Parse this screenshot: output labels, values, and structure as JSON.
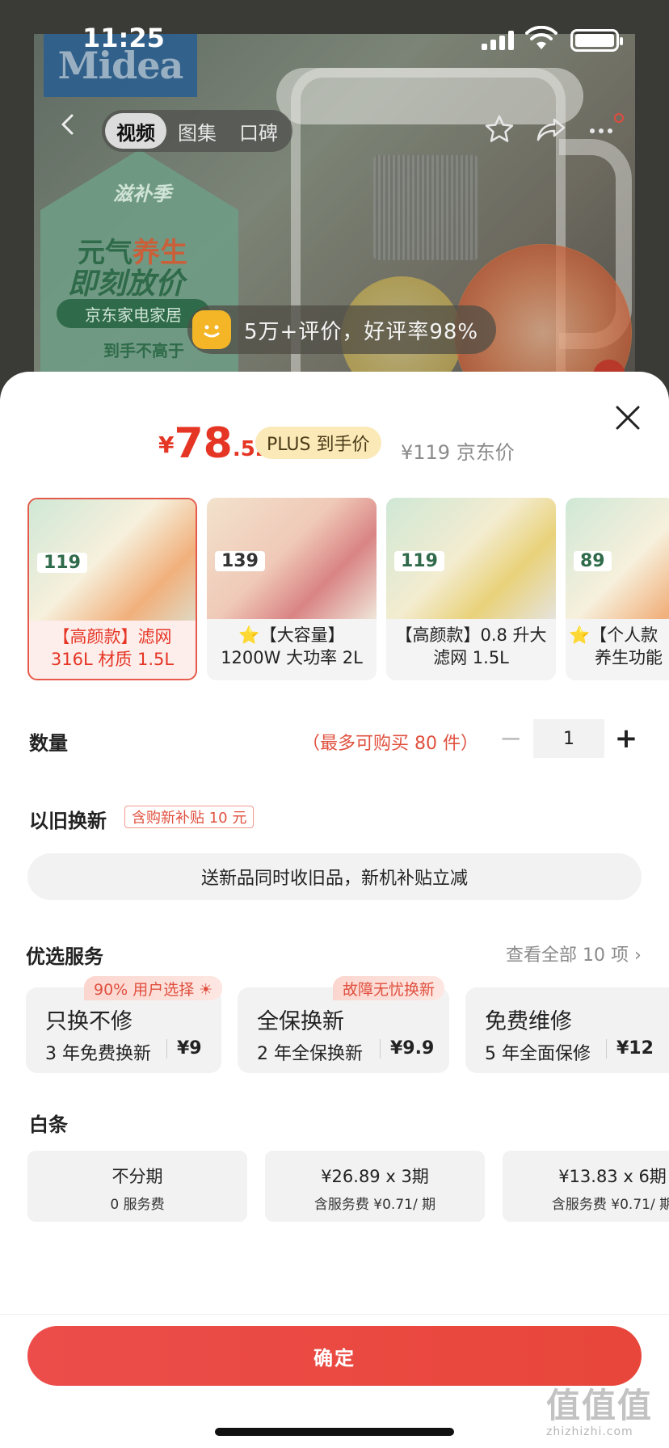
{
  "status_bar": {
    "time": "11:25"
  },
  "hero": {
    "brand": "Midea",
    "promo_line1": "滋补季",
    "promo_line2a": "元气",
    "promo_line2b": "养生",
    "promo_line3": "即刻放价",
    "promo_bar": "京东家电家居",
    "promo_line4": "到手不高于"
  },
  "nav": {
    "tabs": [
      {
        "label": "视频",
        "active": true
      },
      {
        "label": "图集",
        "active": false
      },
      {
        "label": "口碑",
        "active": false
      }
    ],
    "icons": [
      "back-icon",
      "star-icon",
      "share-icon",
      "more-icon"
    ]
  },
  "review": {
    "text": "5万+评价，好评率98%"
  },
  "price": {
    "symbol": "¥",
    "integer": "78",
    "decimal": ".52",
    "plus_label": "PLUS 到手价",
    "jd_price": "¥119 京东价"
  },
  "variants": [
    {
      "line1": "【高颜款】滤网",
      "line2": "316L 材质 1.5L",
      "img_price": "119",
      "selected": true
    },
    {
      "line1": "⭐【大容量】",
      "line2": "1200W 大功率 2L",
      "img_price": "139",
      "selected": false
    },
    {
      "line1": "【高颜款】0.8 升大",
      "line2": "滤网 1.5L",
      "img_price": "119",
      "selected": false
    },
    {
      "line1": "⭐【个人款",
      "line2": "养生功能",
      "img_price": "89",
      "selected": false
    }
  ],
  "quantity": {
    "label": "数量",
    "limit": "（最多可购买 80 件）",
    "minus": "−",
    "value": "1",
    "plus": "+"
  },
  "trade_in": {
    "label": "以旧换新",
    "tag": "含购新补贴 10 元",
    "button": "送新品同时收旧品，新机补贴立减"
  },
  "services": {
    "label": "优选服务",
    "view_all": "查看全部 10 项 ›",
    "items": [
      {
        "tag": "90% 用户选择 ☀",
        "title": "只换不修",
        "sub": "3 年免费换新",
        "price": "¥9"
      },
      {
        "tag": "故障无忧换新",
        "title": "全保换新",
        "sub": "2 年全保换新",
        "price": "¥9.9"
      },
      {
        "tag": "",
        "title": "免费维修",
        "sub": "5 年全面保修",
        "price": "¥12"
      }
    ]
  },
  "baitiao": {
    "label": "白条",
    "options": [
      {
        "title": "不分期",
        "sub": "0 服务费"
      },
      {
        "title": "¥26.89 x 3期",
        "sub": "含服务费 ¥0.71/ 期"
      },
      {
        "title": "¥13.83 x 6期",
        "sub": "含服务费 ¥0.71/ 期"
      }
    ]
  },
  "confirm": {
    "label": "确定"
  },
  "watermark": {
    "main": "值值值",
    "sub": "zhizhizhi.com"
  },
  "colors": {
    "accent": "#e53524",
    "confirm": "#e8463a",
    "plus_bg": "#fbe9b7"
  }
}
